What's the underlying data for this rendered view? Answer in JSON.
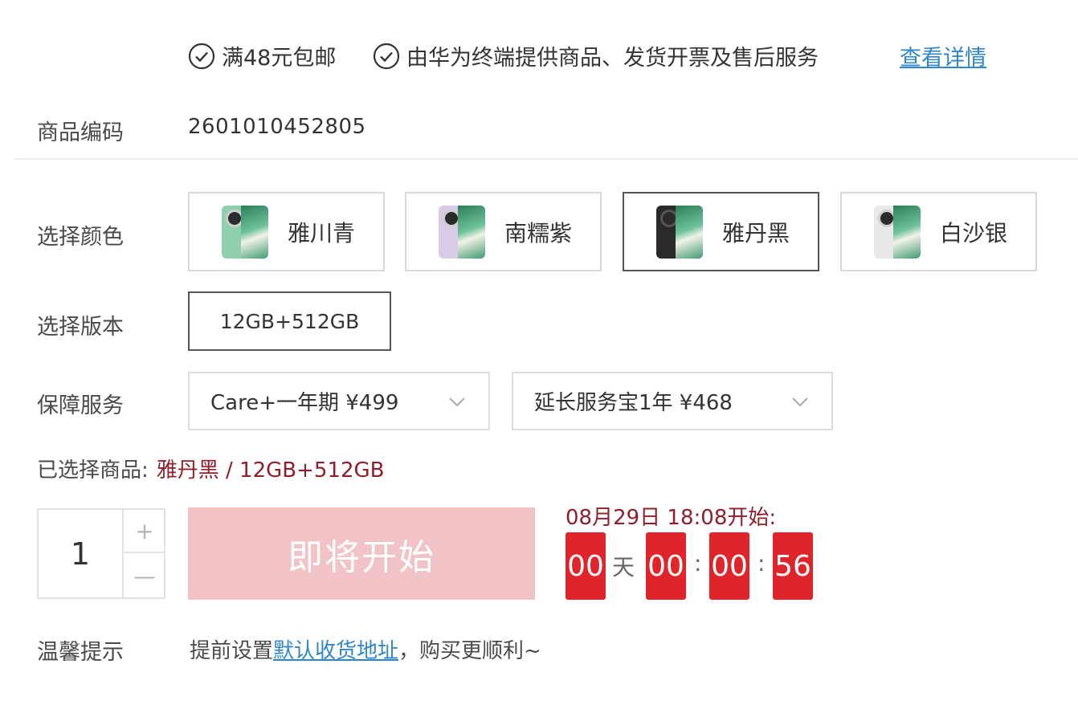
{
  "services": {
    "free_shipping": "满48元包邮",
    "provider": "由华为终端提供商品、发货开票及售后服务",
    "detail_link": "查看详情"
  },
  "product_code": {
    "label": "商品编码",
    "value": "2601010452805"
  },
  "color": {
    "label": "选择颜色",
    "options": [
      {
        "name": "雅川青",
        "thumb_color": "#8fcfb0",
        "selected": false
      },
      {
        "name": "南糯紫",
        "thumb_color": "#d9cbe6",
        "selected": false
      },
      {
        "name": "雅丹黑",
        "thumb_color": "#2a2a2a",
        "selected": true
      },
      {
        "name": "白沙银",
        "thumb_color": "#e8e8e8",
        "selected": false
      }
    ]
  },
  "version": {
    "label": "选择版本",
    "options": [
      "12GB+512GB"
    ]
  },
  "protection": {
    "label": "保障服务",
    "options": [
      "Care+一年期 ¥499",
      "延长服务宝1年 ¥468"
    ]
  },
  "selected_product": {
    "label": "已选择商品:",
    "value": "雅丹黑 / 12GB+512GB"
  },
  "quantity": {
    "value": "1",
    "plus": "+",
    "minus": "—"
  },
  "buy_button": {
    "label": "即将开始"
  },
  "countdown": {
    "start_text": "08月29日 18:08开始:",
    "days": "00",
    "day_unit": "天",
    "hours": "00",
    "minutes": "00",
    "seconds": "56",
    "separator": ":"
  },
  "tip": {
    "label": "温馨提示",
    "prefix": "提前设置",
    "link": "默认收货地址",
    "suffix": "，购买更顺利~"
  },
  "colors": {
    "accent_red": "#e0242b",
    "price_red": "#8e1f2b",
    "link_blue": "#2f86c9",
    "button_disabled": "#f1c3c7"
  }
}
